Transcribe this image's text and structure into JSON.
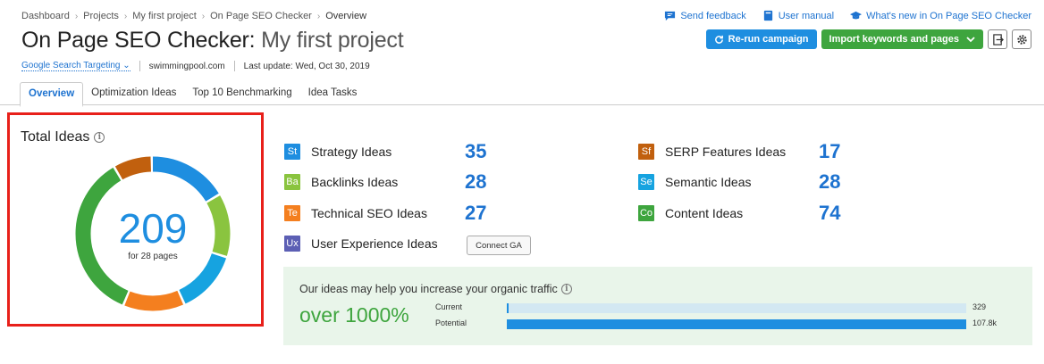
{
  "breadcrumb": [
    "Dashboard",
    "Projects",
    "My first project",
    "On Page SEO Checker",
    "Overview"
  ],
  "top_links": {
    "feedback": "Send feedback",
    "manual": "User manual",
    "whats_new": "What's new in On Page SEO Checker"
  },
  "title": {
    "tool": "On Page SEO Checker:",
    "project": "My first project"
  },
  "buttons": {
    "rerun": "Re-run campaign",
    "import": "Import keywords and pages"
  },
  "subline": {
    "targeting": "Google Search Targeting",
    "domain": "swimmingpool.com",
    "last_update": "Last update: Wed, Oct 30, 2019"
  },
  "tabs": [
    "Overview",
    "Optimization Ideas",
    "Top 10 Benchmarking",
    "Idea Tasks"
  ],
  "total": {
    "title": "Total Ideas",
    "count": "209",
    "pages": "for 28 pages"
  },
  "ideas": [
    {
      "abbr": "St",
      "name": "Strategy Ideas",
      "count": "35",
      "color": "#1e8ee0"
    },
    {
      "abbr": "Ba",
      "name": "Backlinks Ideas",
      "count": "28",
      "color": "#8ac43f"
    },
    {
      "abbr": "Te",
      "name": "Technical SEO Ideas",
      "count": "27",
      "color": "#f47f1f"
    },
    {
      "abbr": "Ux",
      "name": "User Experience Ideas",
      "count": "",
      "color": "#5c5fb4"
    },
    {
      "abbr": "Sf",
      "name": "SERP Features Ideas",
      "count": "17",
      "color": "#c1600e"
    },
    {
      "abbr": "Se",
      "name": "Semantic Ideas",
      "count": "28",
      "color": "#16a3e0"
    },
    {
      "abbr": "Co",
      "name": "Content Ideas",
      "count": "74",
      "color": "#3ea53e"
    }
  ],
  "connect_ga": "Connect GA",
  "traffic": {
    "title": "Our ideas may help you increase your organic traffic",
    "headline": "over 1000%",
    "current_label": "Current",
    "current_value": "329",
    "current_fraction": 0.00305,
    "potential_label": "Potential",
    "potential_value": "107.8k",
    "potential_fraction": 1.0
  }
}
